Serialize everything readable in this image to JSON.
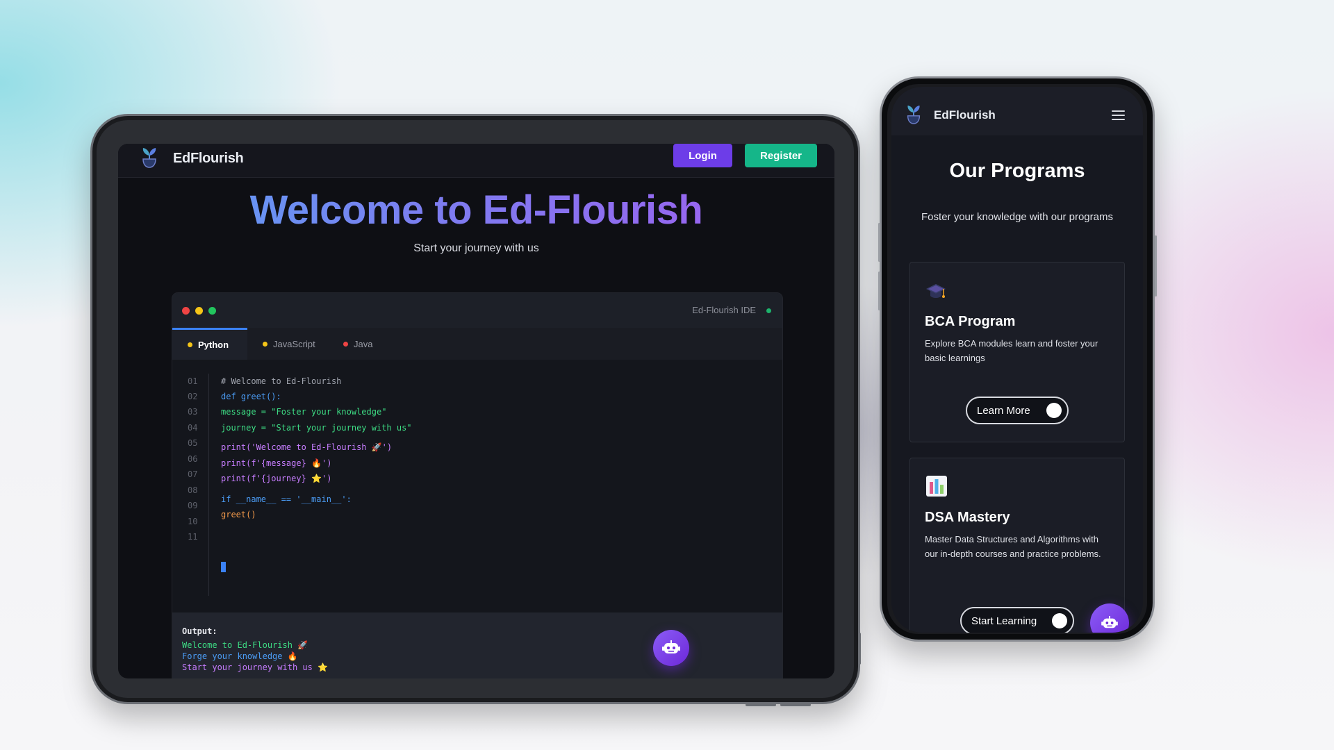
{
  "tablet": {
    "brand": "EdFlourish",
    "nav": {
      "login_label": "Login",
      "register_label": "Register"
    },
    "hero": {
      "title": "Welcome to Ed-Flourish",
      "subtitle": "Start your journey with us"
    },
    "ide": {
      "title": "Ed-Flourish IDE",
      "tabs": [
        {
          "label": "Python",
          "dot_color": "#f5c518",
          "active": true
        },
        {
          "label": "JavaScript",
          "dot_color": "#f5c518",
          "active": false
        },
        {
          "label": "Java",
          "dot_color": "#ef4444",
          "active": false
        }
      ],
      "code_lines": [
        {
          "num": "01",
          "text": "# Welcome to Ed-Flourish",
          "color": "#9fa3ad"
        },
        {
          "num": "02",
          "text": "def greet():",
          "color": "#4b9cf5"
        },
        {
          "num": "03",
          "text": "message = \"Foster your knowledge\"",
          "color": "#3ddc84"
        },
        {
          "num": "04",
          "text": "journey = \"Start your journey with us\"",
          "color": "#3ddc84"
        },
        {
          "num": "05",
          "text": "print('Welcome to Ed-Flourish 🚀')",
          "color": "#c77dff"
        },
        {
          "num": "06",
          "text": "print(f'{message} 🔥')",
          "color": "#c77dff"
        },
        {
          "num": "07",
          "text": "print(f'{journey} ⭐')",
          "color": "#c77dff"
        },
        {
          "num": "08",
          "text": "",
          "color": "#9fa3ad"
        },
        {
          "num": "09",
          "text": "if __name__ == '__main__':",
          "color": "#4b9cf5"
        },
        {
          "num": "10",
          "text": "greet()",
          "color": "#f2994a"
        },
        {
          "num": "11",
          "text": "",
          "color": "#9fa3ad"
        }
      ],
      "output_label": "Output:",
      "output_lines": [
        {
          "text": "Welcome to Ed-Flourish 🚀",
          "color": "#3ddc84"
        },
        {
          "text": "Forge your knowledge 🔥",
          "color": "#4b9cf5"
        },
        {
          "text": "Start your journey with us ⭐",
          "color": "#c77dff"
        }
      ]
    }
  },
  "phone": {
    "brand": "EdFlourish",
    "title": "Our Programs",
    "subtitle": "Foster your knowledge with our programs",
    "cards": [
      {
        "icon": "graduation-cap-icon",
        "title": "BCA Program",
        "description": "Explore BCA modules learn and foster your basic learnings",
        "button_label": "Learn More"
      },
      {
        "icon": "bar-chart-icon",
        "title": "DSA Mastery",
        "description": "Master Data Structures and Algorithms with our in-depth courses and practice problems.",
        "button_label": "Start Learning"
      }
    ]
  },
  "colors": {
    "accent_purple": "#6d3de8",
    "accent_green": "#15b689",
    "accent_blue": "#3b82f6"
  }
}
